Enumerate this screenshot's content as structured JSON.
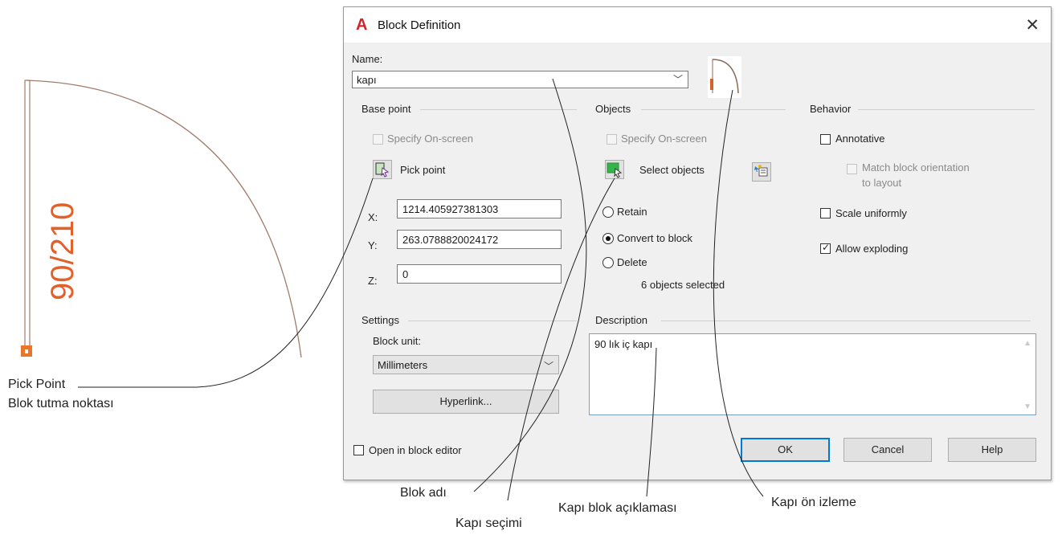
{
  "dialog": {
    "title": "Block Definition",
    "name_label": "Name:",
    "name_value": "kapı",
    "base_point": {
      "heading": "Base point",
      "specify_onscreen": "Specify On-screen",
      "pick_point": "Pick point",
      "x_label": "X:",
      "x_value": "1214.405927381303",
      "y_label": "Y:",
      "y_value": "263.0788820024172",
      "z_label": "Z:",
      "z_value": "0"
    },
    "objects": {
      "heading": "Objects",
      "specify_onscreen": "Specify On-screen",
      "select_objects": "Select objects",
      "retain": "Retain",
      "convert_to_block": "Convert to block",
      "delete": "Delete",
      "selected_radio": "Convert to block",
      "count_text": "6 objects selected"
    },
    "behavior": {
      "heading": "Behavior",
      "annotative": "Annotative",
      "annotative_checked": false,
      "match_orientation_line1": "Match block orientation",
      "match_orientation_line2": "to layout",
      "scale_uniformly": "Scale uniformly",
      "scale_uniformly_checked": false,
      "allow_exploding": "Allow exploding",
      "allow_exploding_checked": true
    },
    "settings": {
      "heading": "Settings",
      "block_unit_label": "Block unit:",
      "block_unit_value": "Millimeters",
      "hyperlink_button": "Hyperlink..."
    },
    "description": {
      "heading": "Description",
      "value": "90 lık iç kapı"
    },
    "open_in_block_editor": "Open in block editor",
    "open_in_block_editor_checked": false,
    "buttons": {
      "ok": "OK",
      "cancel": "Cancel",
      "help": "Help"
    }
  },
  "drawing": {
    "dimension_text": "90/210",
    "accent_color": "#e2602a",
    "arc_color": "#a07c6c"
  },
  "annotations": {
    "pick_point_line1": "Pick Point",
    "pick_point_line2": "Blok tutma noktası",
    "block_name": "Blok adı",
    "door_selection": "Kapı seçimi",
    "block_description": "Kapı blok açıklaması",
    "door_preview": "Kapı ön izleme"
  }
}
